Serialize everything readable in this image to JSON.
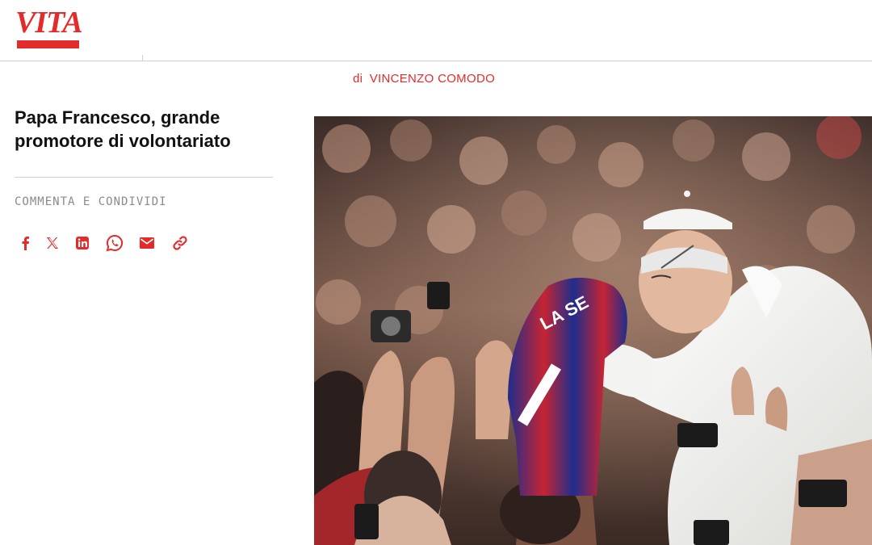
{
  "header": {
    "logo_text": "VITA",
    "brand_color": "#e32b2b"
  },
  "article": {
    "author_prefix": "di",
    "author_name": "VINCENZO COMODO",
    "title": "Papa Francesco, grande promotore di volontariato",
    "share_label": "COMMENTA E CONDIVIDI",
    "share_icons": [
      "facebook-icon",
      "x-icon",
      "linkedin-icon",
      "whatsapp-icon",
      "mail-icon",
      "link-icon"
    ],
    "accent_color": "#e32b2b"
  },
  "hero_image": {
    "jersey_text": "LA SE"
  }
}
